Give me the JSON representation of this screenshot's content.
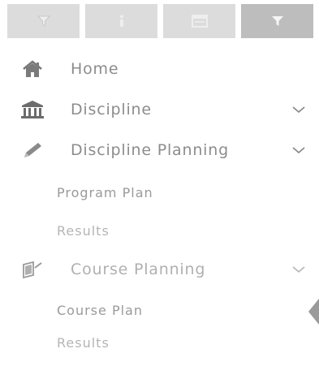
{
  "toolbar": {
    "buttons": [
      {
        "name": "filter-button",
        "icon": "filter-icon"
      },
      {
        "name": "info-button",
        "icon": "info-icon"
      },
      {
        "name": "window-button",
        "icon": "window-icon"
      },
      {
        "name": "filter-button-active",
        "icon": "filter-icon"
      }
    ]
  },
  "nav": {
    "home": {
      "label": "Home",
      "icon": "home-icon"
    },
    "discipline": {
      "label": "Discipline",
      "icon": "building-icon"
    },
    "discipline_planning": {
      "label": "Discipline Planning",
      "icon": "pencil-icon",
      "children": [
        {
          "label": "Program Plan"
        },
        {
          "label": "Results"
        }
      ]
    },
    "course_planning": {
      "label": "Course Planning",
      "icon": "book-icon",
      "children": [
        {
          "label": "Course Plan"
        },
        {
          "label": "Results"
        }
      ]
    }
  },
  "colors": {
    "toolbar_button": "#dcdcdc",
    "toolbar_button_active": "#bdbdbd",
    "text": "#8c8c8c"
  }
}
